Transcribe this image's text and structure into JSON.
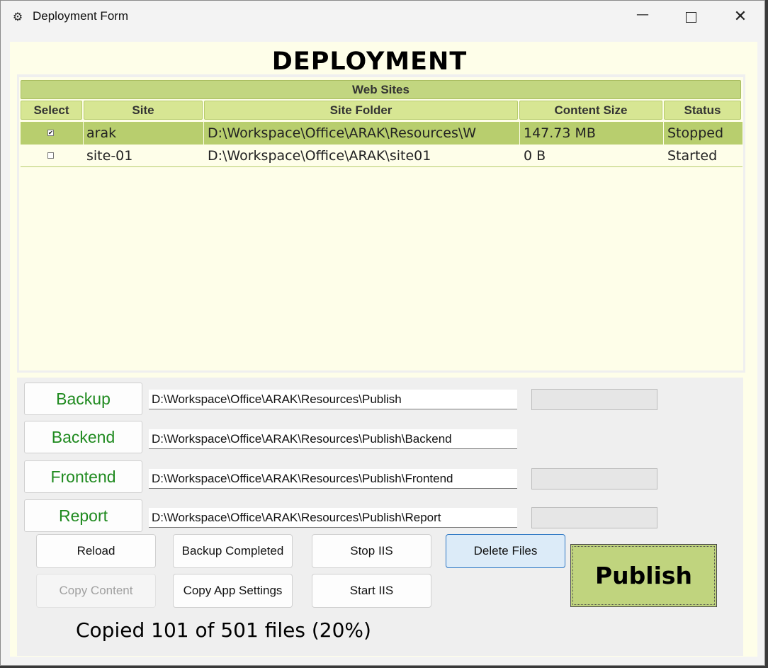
{
  "window": {
    "title": "Deployment Form",
    "icon": "app-gear-icon"
  },
  "heading": "DEPLOYMENT",
  "grid": {
    "group_title": "Web Sites",
    "columns": [
      "Select",
      "Site",
      "Site Folder",
      "Content Size",
      "Status"
    ],
    "rows": [
      {
        "selected": true,
        "checked": true,
        "site": "arak",
        "folder": "D:\\Workspace\\Office\\ARAK\\Resources\\W",
        "size": "147.73 MB",
        "status": "Stopped"
      },
      {
        "selected": false,
        "checked": false,
        "site": "site-01",
        "folder": "D:\\Workspace\\Office\\ARAK\\site01",
        "size": "0 B",
        "status": "Started"
      }
    ]
  },
  "paths": [
    {
      "label": "Backup",
      "value": "D:\\Workspace\\Office\\ARAK\\Resources\\Publish",
      "has_progress": true
    },
    {
      "label": "Backend",
      "value": "D:\\Workspace\\Office\\ARAK\\Resources\\Publish\\Backend",
      "has_progress": false
    },
    {
      "label": "Frontend",
      "value": "D:\\Workspace\\Office\\ARAK\\Resources\\Publish\\Frontend",
      "has_progress": true
    },
    {
      "label": "Report",
      "value": "D:\\Workspace\\Office\\ARAK\\Resources\\Publish\\Report",
      "has_progress": true
    }
  ],
  "actions": {
    "reload": "Reload",
    "backup_completed": "Backup Completed",
    "stop_iis": "Stop IIS",
    "delete_files": "Delete Files",
    "copy_content": "Copy Content",
    "copy_app_settings": "Copy App Settings",
    "start_iis": "Start IIS",
    "publish": "Publish"
  },
  "status": {
    "text": "Copied 101 of 501 files (20%)"
  },
  "colors": {
    "accent_green": "#c0d47e",
    "header_green": "#d7e693",
    "label_green": "#1f8a1f",
    "background": "#fefee9"
  }
}
